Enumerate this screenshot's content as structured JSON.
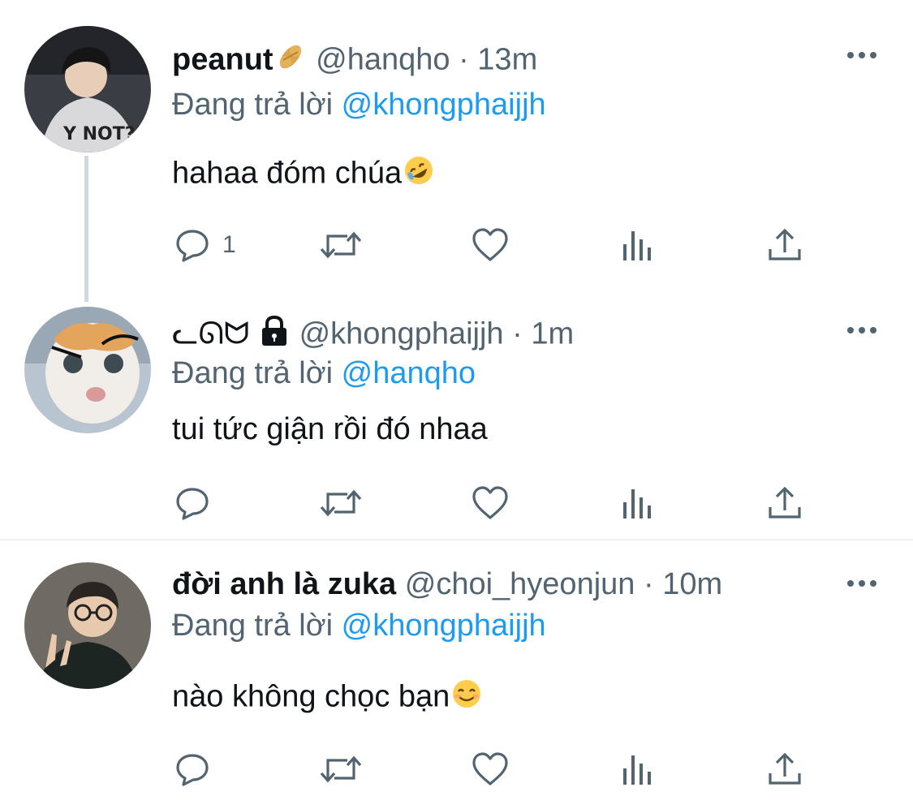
{
  "colors": {
    "accent": "#1d9bf0",
    "secondary_text": "#536471",
    "primary_text": "#0f1419",
    "thread_line": "#cfd9de",
    "divider": "#eff3f4"
  },
  "tweets": [
    {
      "name": "peanut",
      "name_emoji": "peanut-emoji",
      "handle": "@hanqho",
      "separator": "·",
      "time": "13m",
      "replying_prefix": "Đang trả lời",
      "replying_to": "@khongphaijjh",
      "text": "hahaa đóm chúa",
      "text_emoji": "rolling-on-floor-laughing-emoji",
      "reply_count": "1",
      "avatar": "person-in-hoodie-avatar"
    },
    {
      "name": "ᓚᘏᗢ",
      "name_icon": "lock-icon",
      "handle": "@khongphaijjh",
      "separator": "·",
      "time": "1m",
      "replying_prefix": "Đang trả lời",
      "replying_to": "@hanqho",
      "text": "tui tức giận rồi đó nhaa",
      "reply_count": "",
      "avatar": "cat-avatar"
    },
    {
      "name": "đời anh là zuka",
      "handle": "@choi_hyeonjun",
      "separator": "·",
      "time": "10m",
      "replying_prefix": "Đang trả lời",
      "replying_to": "@khongphaijjh",
      "text": "nào không chọc bạn",
      "text_emoji": "smiling-face-emoji",
      "reply_count": "",
      "avatar": "person-with-glasses-avatar"
    }
  ]
}
